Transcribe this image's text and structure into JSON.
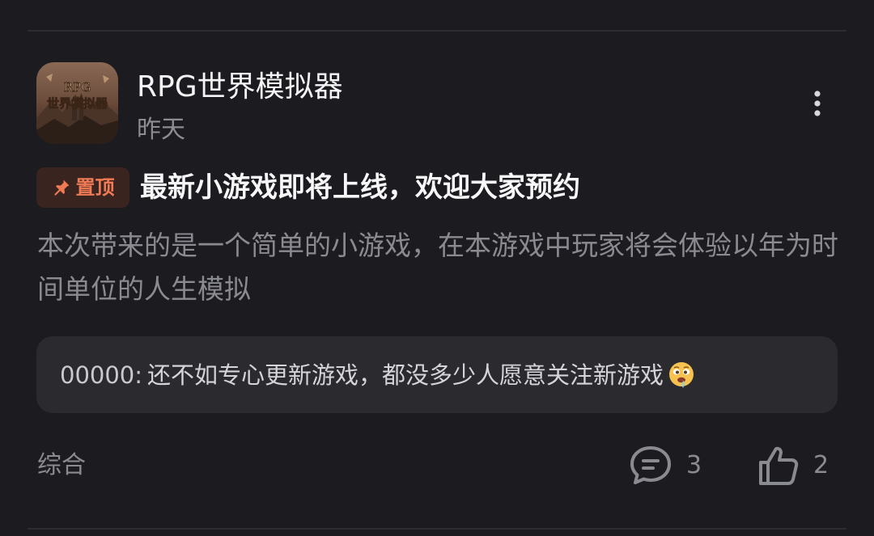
{
  "post": {
    "author": {
      "name": "RPG世界模拟器",
      "avatar_text": "RPG\n世界模拟器",
      "avatar_icon": "game-logo"
    },
    "time": "昨天",
    "menu_icon": "more-vertical-icon",
    "pin": {
      "icon": "pin-icon",
      "label": "置顶",
      "color": "#f07a54"
    },
    "title": "最新小游戏即将上线，欢迎大家预约",
    "body": "本次带来的是一个简单的小游戏，在本游戏中玩家将会体验以年为时间单位的人生模拟",
    "comment_preview": {
      "user": "00000",
      "separator": ":",
      "text": "还不如专心更新游戏，都没多少人愿意关注新游戏",
      "emoji": "drooling-face-emoji"
    },
    "category": "综合",
    "actions": {
      "comments": {
        "icon": "comment-icon",
        "count": "3"
      },
      "likes": {
        "icon": "thumbs-up-icon",
        "count": "2"
      }
    }
  },
  "colors": {
    "background": "#1c1c20",
    "card": "#2a2a2f",
    "muted_text": "#8a8a91",
    "accent": "#f07a54"
  }
}
